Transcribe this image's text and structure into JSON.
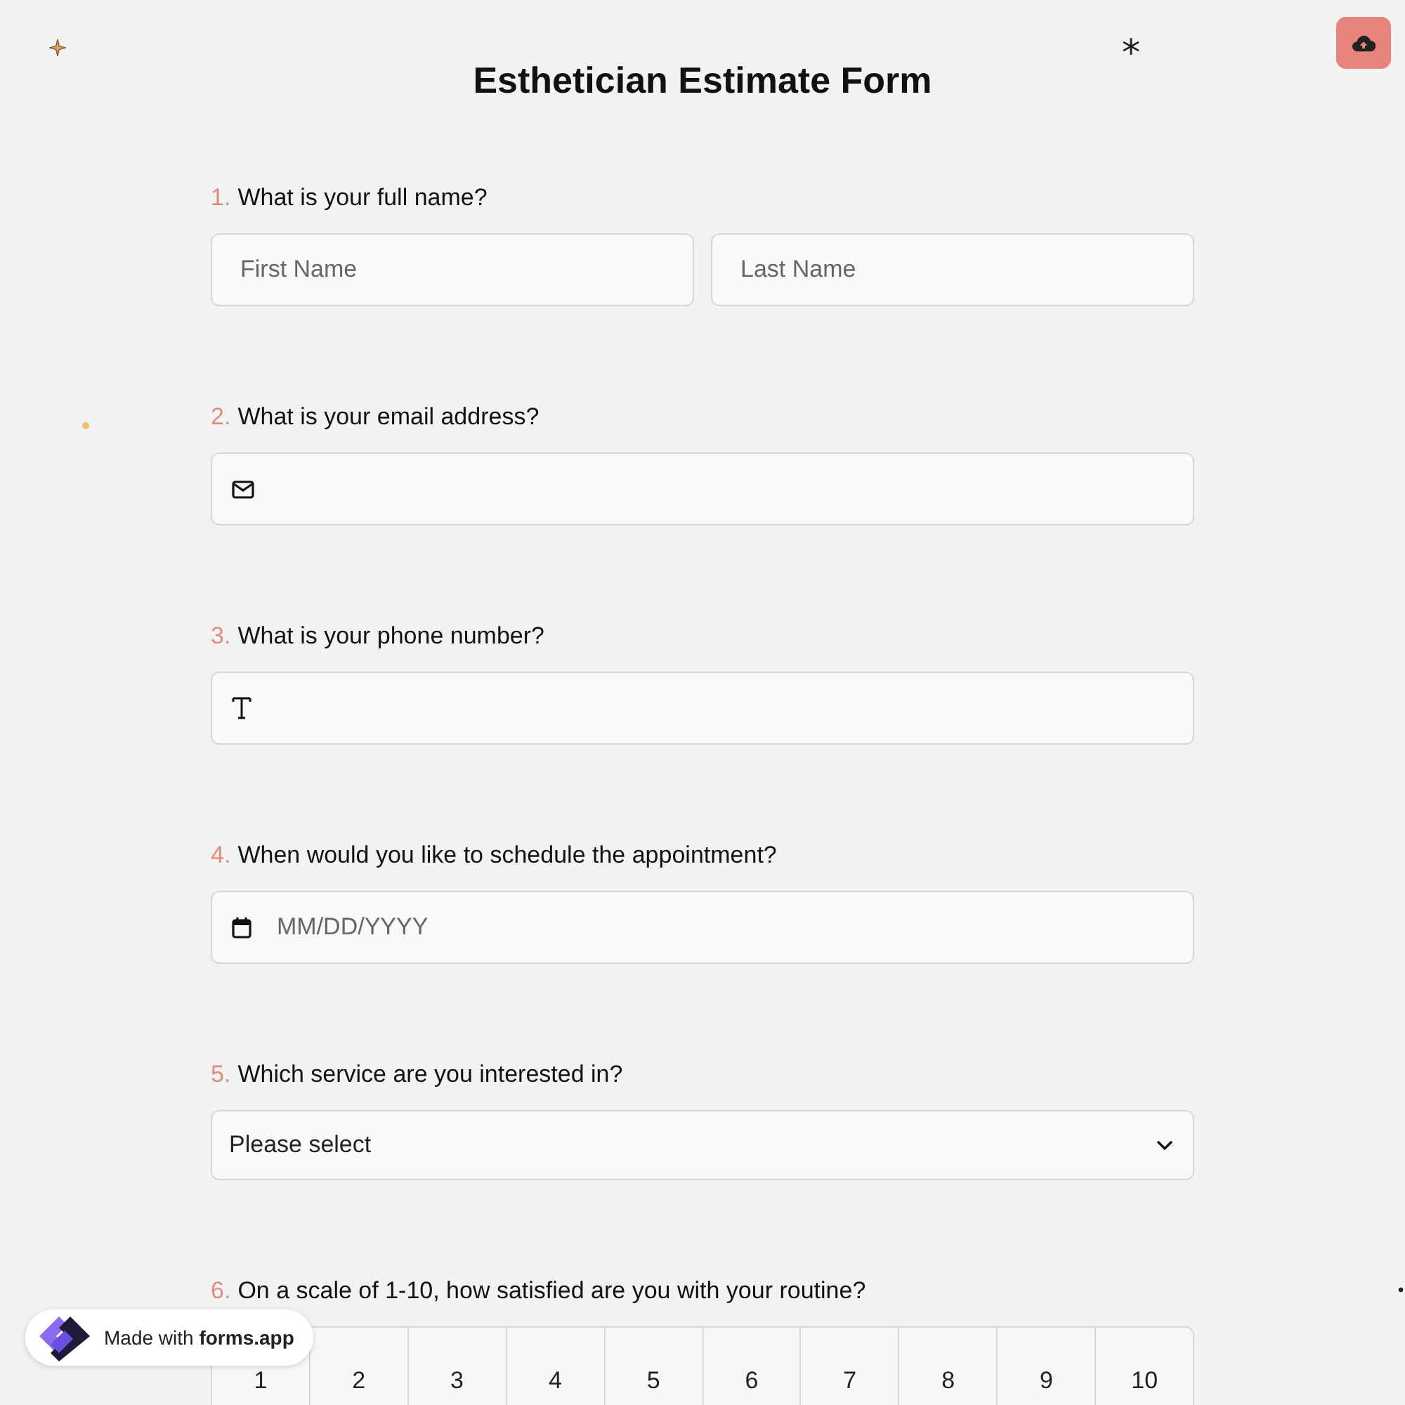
{
  "title": "Esthetician Estimate Form",
  "questions": [
    {
      "number": "1.",
      "label": "What is your full name?",
      "kind": "name",
      "fields": [
        {
          "placeholder": "First Name"
        },
        {
          "placeholder": "Last Name"
        }
      ]
    },
    {
      "number": "2.",
      "label": "What is your email address?",
      "kind": "email"
    },
    {
      "number": "3.",
      "label": "What is your phone number?",
      "kind": "text"
    },
    {
      "number": "4.",
      "label": "When would you like to schedule the appointment?",
      "kind": "date",
      "placeholder": "MM/DD/YYYY"
    },
    {
      "number": "5.",
      "label": "Which service are you interested in?",
      "kind": "select",
      "value": "Please select"
    },
    {
      "number": "6.",
      "label": "On a scale of 1-10, how satisfied are you with your routine?",
      "kind": "scale",
      "options": [
        "1",
        "2",
        "3",
        "4",
        "5",
        "6",
        "7",
        "8",
        "9",
        "10"
      ]
    }
  ],
  "badge": "Made with **forms.app**"
}
